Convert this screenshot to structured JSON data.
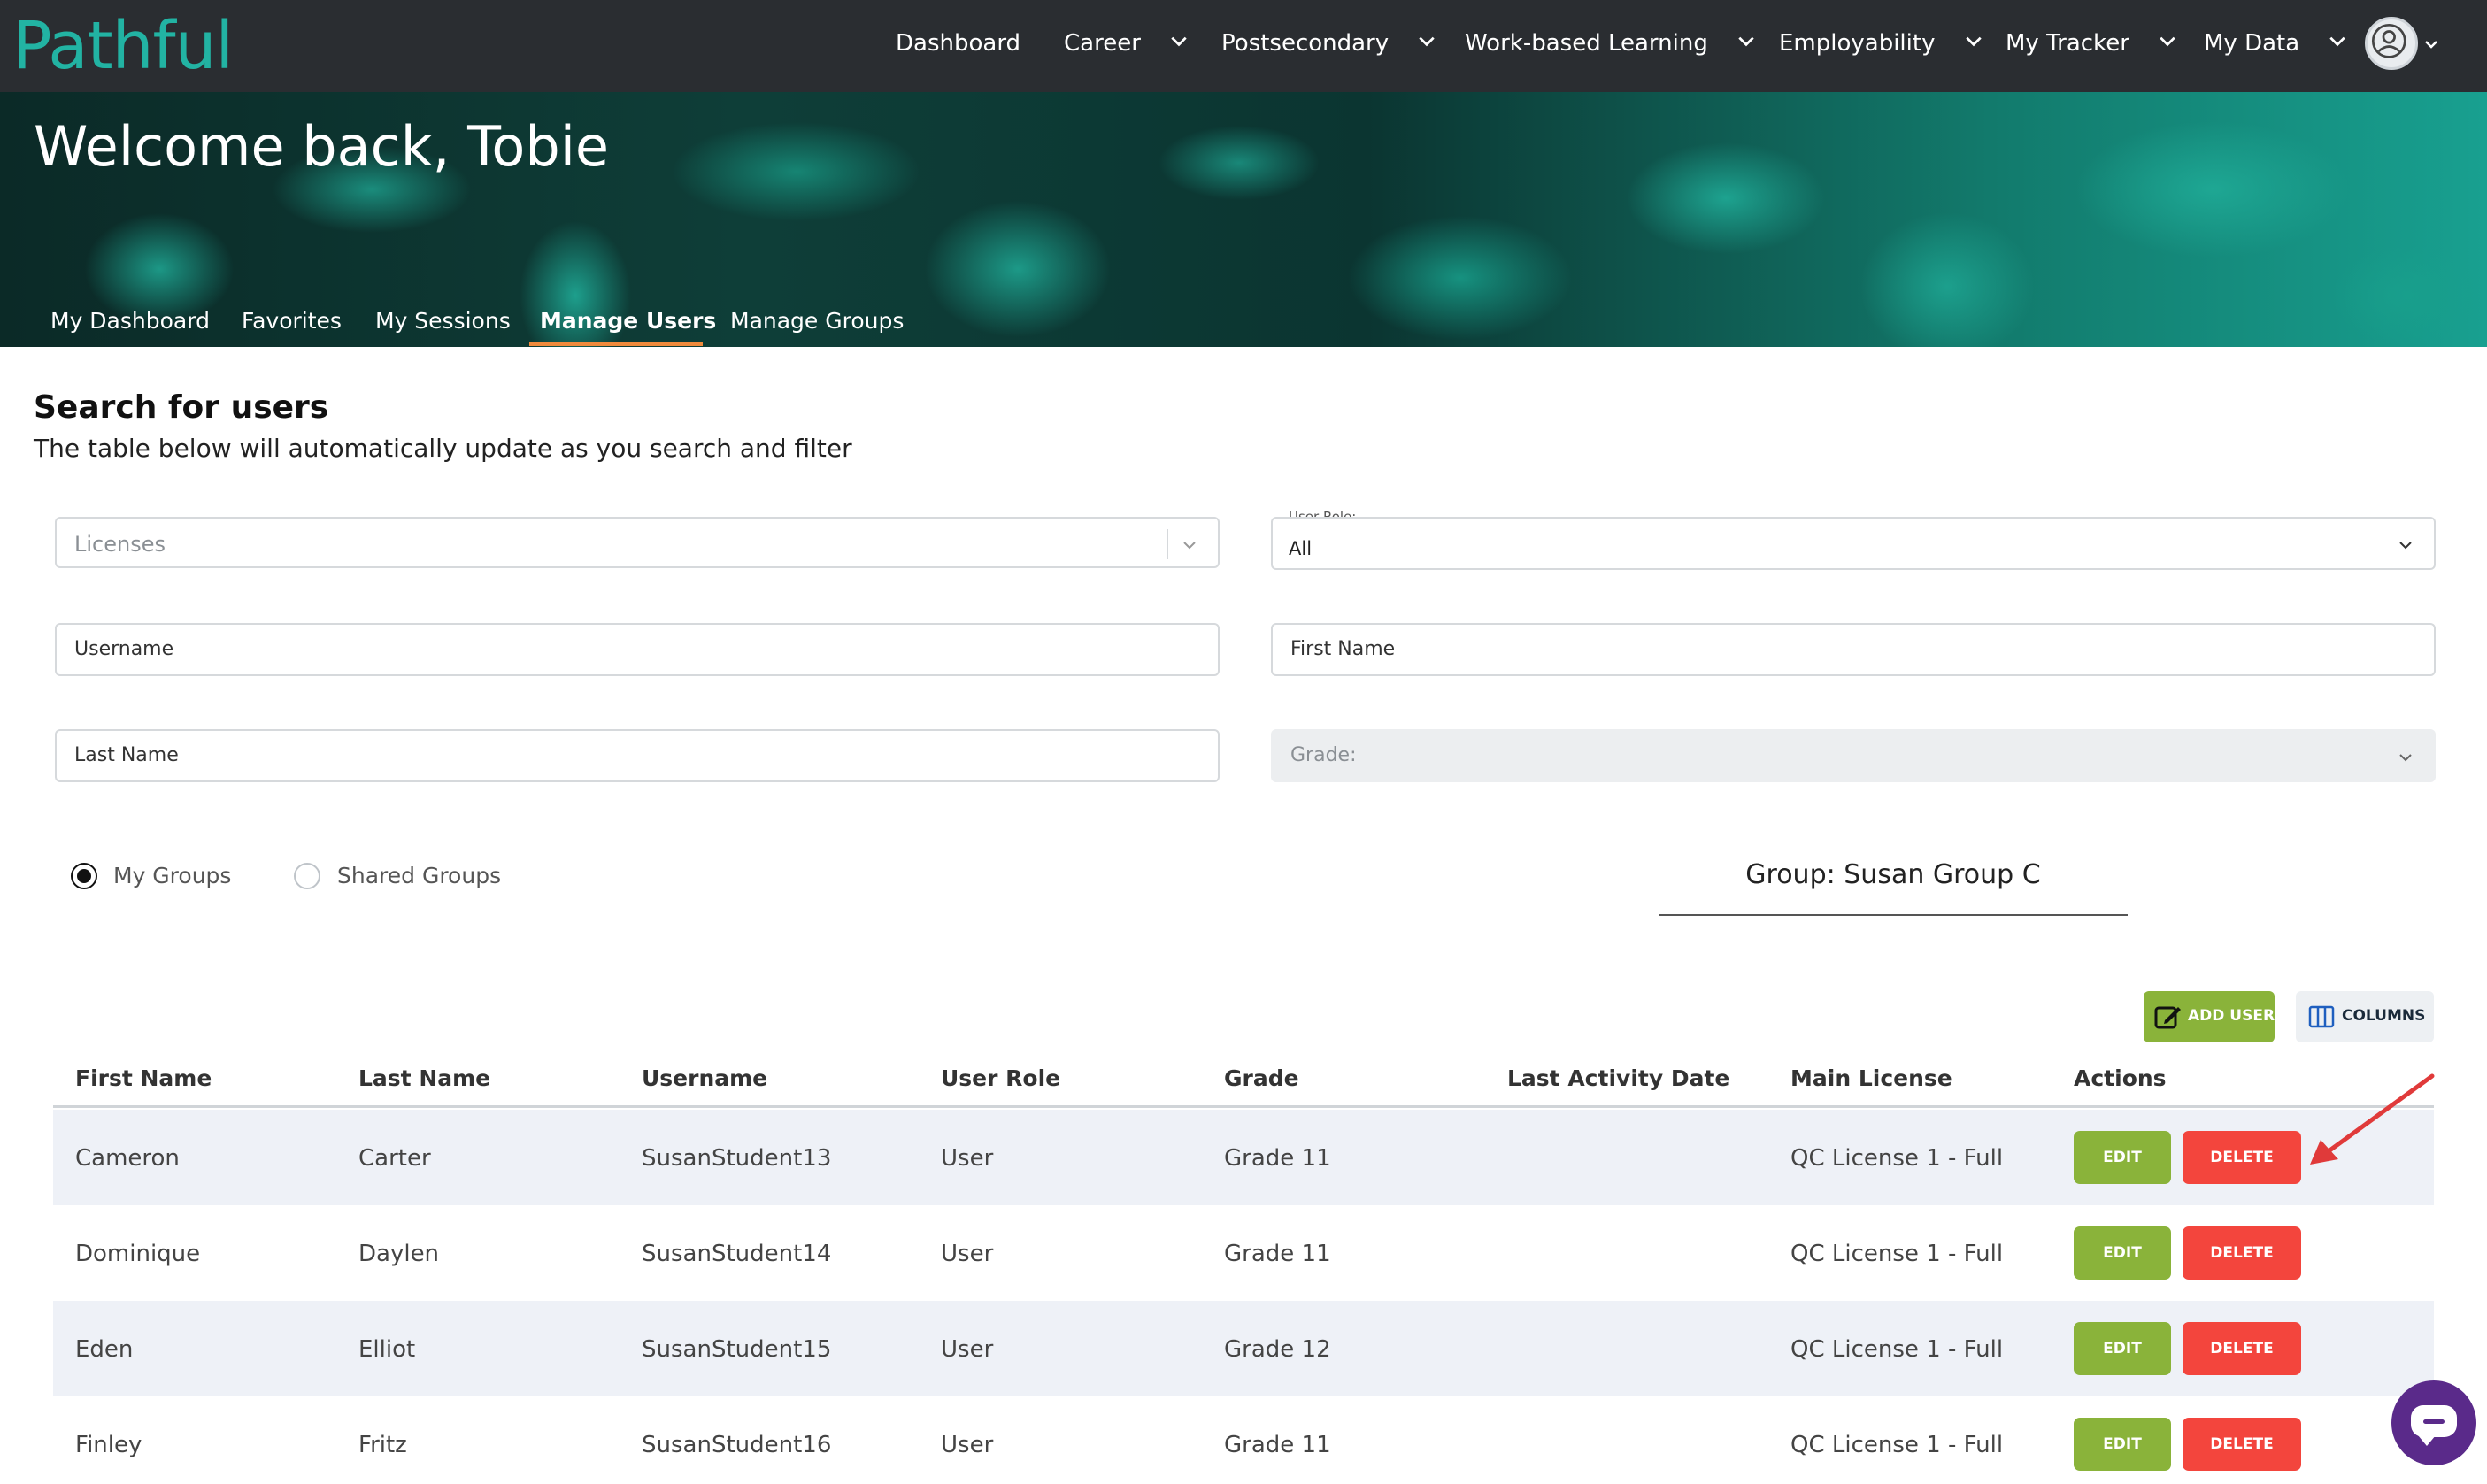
{
  "app": {
    "logo_text": "Pathful"
  },
  "topnav": {
    "items": [
      {
        "label": "Dashboard",
        "has_chevron": false
      },
      {
        "label": "Career",
        "has_chevron": true
      },
      {
        "label": "Postsecondary",
        "has_chevron": true
      },
      {
        "label": "Work-based Learning",
        "has_chevron": true
      },
      {
        "label": "Employability",
        "has_chevron": true
      },
      {
        "label": "My Tracker",
        "has_chevron": true
      },
      {
        "label": "My Data",
        "has_chevron": true
      }
    ],
    "avatar_icon": "user-circle-icon"
  },
  "banner": {
    "title": "Welcome back, Tobie",
    "tabs": [
      {
        "label": "My Dashboard",
        "active": false
      },
      {
        "label": "Favorites",
        "active": false
      },
      {
        "label": "My Sessions",
        "active": false
      },
      {
        "label": "Manage Users",
        "active": true
      },
      {
        "label": "Manage Groups",
        "active": false
      }
    ]
  },
  "search": {
    "title": "Search for users",
    "subtitle": "The table below will automatically update as you search and filter",
    "licenses_placeholder": "Licenses",
    "user_role_label": "User Role:",
    "user_role_value": "All",
    "username_placeholder": "Username",
    "first_name_placeholder": "First Name",
    "last_name_placeholder": "Last Name",
    "grade_placeholder": "Grade:",
    "radios": [
      {
        "label": "My Groups",
        "checked": true
      },
      {
        "label": "Shared Groups",
        "checked": false
      }
    ],
    "group_label": "Group: Susan Group C"
  },
  "toolbar": {
    "add_user_label": "ADD USER",
    "columns_label": "COLUMNS"
  },
  "table": {
    "headers": [
      "First Name",
      "Last Name",
      "Username",
      "User Role",
      "Grade",
      "Last Activity Date",
      "Main License",
      "Actions"
    ],
    "rows": [
      {
        "first": "Cameron",
        "last": "Carter",
        "username": "SusanStudent13",
        "role": "User",
        "grade": "Grade 11",
        "last_activity": "",
        "license": "QC License 1 - Full"
      },
      {
        "first": "Dominique",
        "last": "Daylen",
        "username": "SusanStudent14",
        "role": "User",
        "grade": "Grade 11",
        "last_activity": "",
        "license": "QC License 1 - Full"
      },
      {
        "first": "Eden",
        "last": "Elliot",
        "username": "SusanStudent15",
        "role": "User",
        "grade": "Grade 12",
        "last_activity": "",
        "license": "QC License 1 - Full"
      },
      {
        "first": "Finley",
        "last": "Fritz",
        "username": "SusanStudent16",
        "role": "User",
        "grade": "Grade 11",
        "last_activity": "",
        "license": "QC License 1 - Full"
      }
    ],
    "edit_label": "EDIT",
    "delete_label": "DELETE"
  },
  "colors": {
    "nav_bg": "#2a2d31",
    "brand_teal": "#22b3a3",
    "accent_orange": "#f08a3c",
    "edit_green": "#8ab33a",
    "delete_red": "#f3453d",
    "row_shade": "#eef1f7",
    "annotation_arrow": "#e03a3a",
    "chat_purple": "#5a2a8a"
  }
}
